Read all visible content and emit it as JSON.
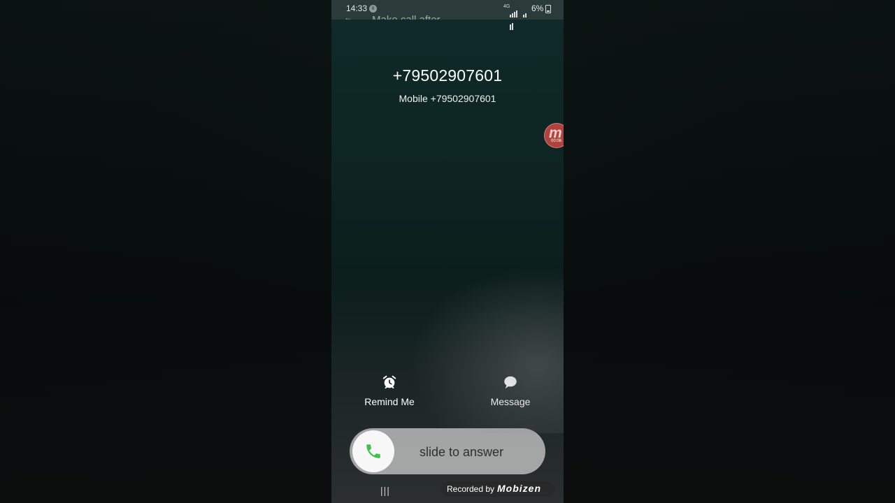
{
  "status_bar": {
    "time": "14:33",
    "notification_badge": "8",
    "network": "4G",
    "battery": "6%"
  },
  "header": {
    "title_ghost": "Make call after",
    "back_icon": "arrow-left-icon"
  },
  "caller": {
    "number": "+79502907601",
    "subtitle": "Mobile +79502907601"
  },
  "recorder_bubble": {
    "logo": "m",
    "timer": "00:06"
  },
  "actions": {
    "remind": {
      "label": "Remind Me",
      "icon": "alarm-clock-icon"
    },
    "message": {
      "label": "Message",
      "icon": "chat-bubble-icon"
    }
  },
  "slider": {
    "label": "slide to answer",
    "icon": "phone-icon",
    "accent": "#3cc24a"
  },
  "nav": {
    "recents": "|||"
  },
  "watermark": {
    "prefix": "Recorded by",
    "brand": "Mobizen"
  }
}
